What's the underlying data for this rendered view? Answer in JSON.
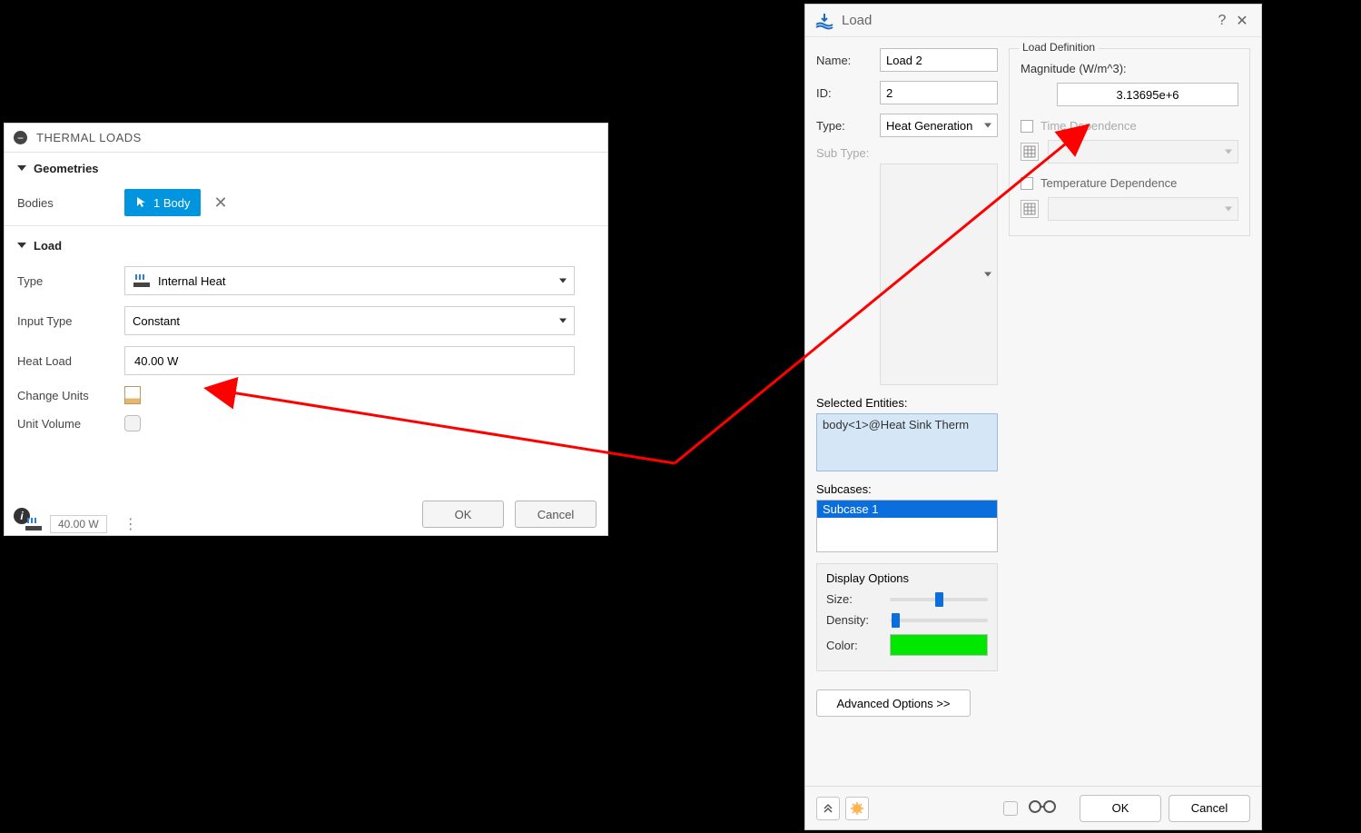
{
  "left_panel": {
    "title": "THERMAL LOADS",
    "geometries": {
      "header": "Geometries",
      "bodies_label": "Bodies",
      "body_chip": "1 Body"
    },
    "load": {
      "header": "Load",
      "type_label": "Type",
      "type_value": "Internal Heat",
      "input_type_label": "Input Type",
      "input_type_value": "Constant",
      "heat_load_label": "Heat Load",
      "heat_load_value": "40.00 W",
      "change_units_label": "Change Units",
      "unit_volume_label": "Unit Volume"
    },
    "buttons": {
      "ok": "OK",
      "cancel": "Cancel"
    },
    "footer_value": "40.00 W"
  },
  "right_dialog": {
    "title": "Load",
    "name_label": "Name:",
    "name_value": "Load 2",
    "id_label": "ID:",
    "id_value": "2",
    "type_label": "Type:",
    "type_value": "Heat Generation",
    "subtype_label": "Sub Type:",
    "selected_entities_label": "Selected Entities:",
    "selected_entities_value": "body<1>@Heat Sink Therm",
    "subcases_label": "Subcases:",
    "subcase_value": "Subcase 1",
    "display": {
      "header": "Display Options",
      "size_label": "Size:",
      "density_label": "Density:",
      "color_label": "Color:",
      "color_value": "#00e800"
    },
    "advanced_label": "Advanced Options >>",
    "definition": {
      "legend": "Load Definition",
      "magnitude_label": "Magnitude (W/m^3):",
      "magnitude_value": "3.13695e+6",
      "time_dep_label": "Time Dependence",
      "temp_dep_label": "Temperature Dependence"
    },
    "buttons": {
      "ok": "OK",
      "cancel": "Cancel"
    }
  }
}
